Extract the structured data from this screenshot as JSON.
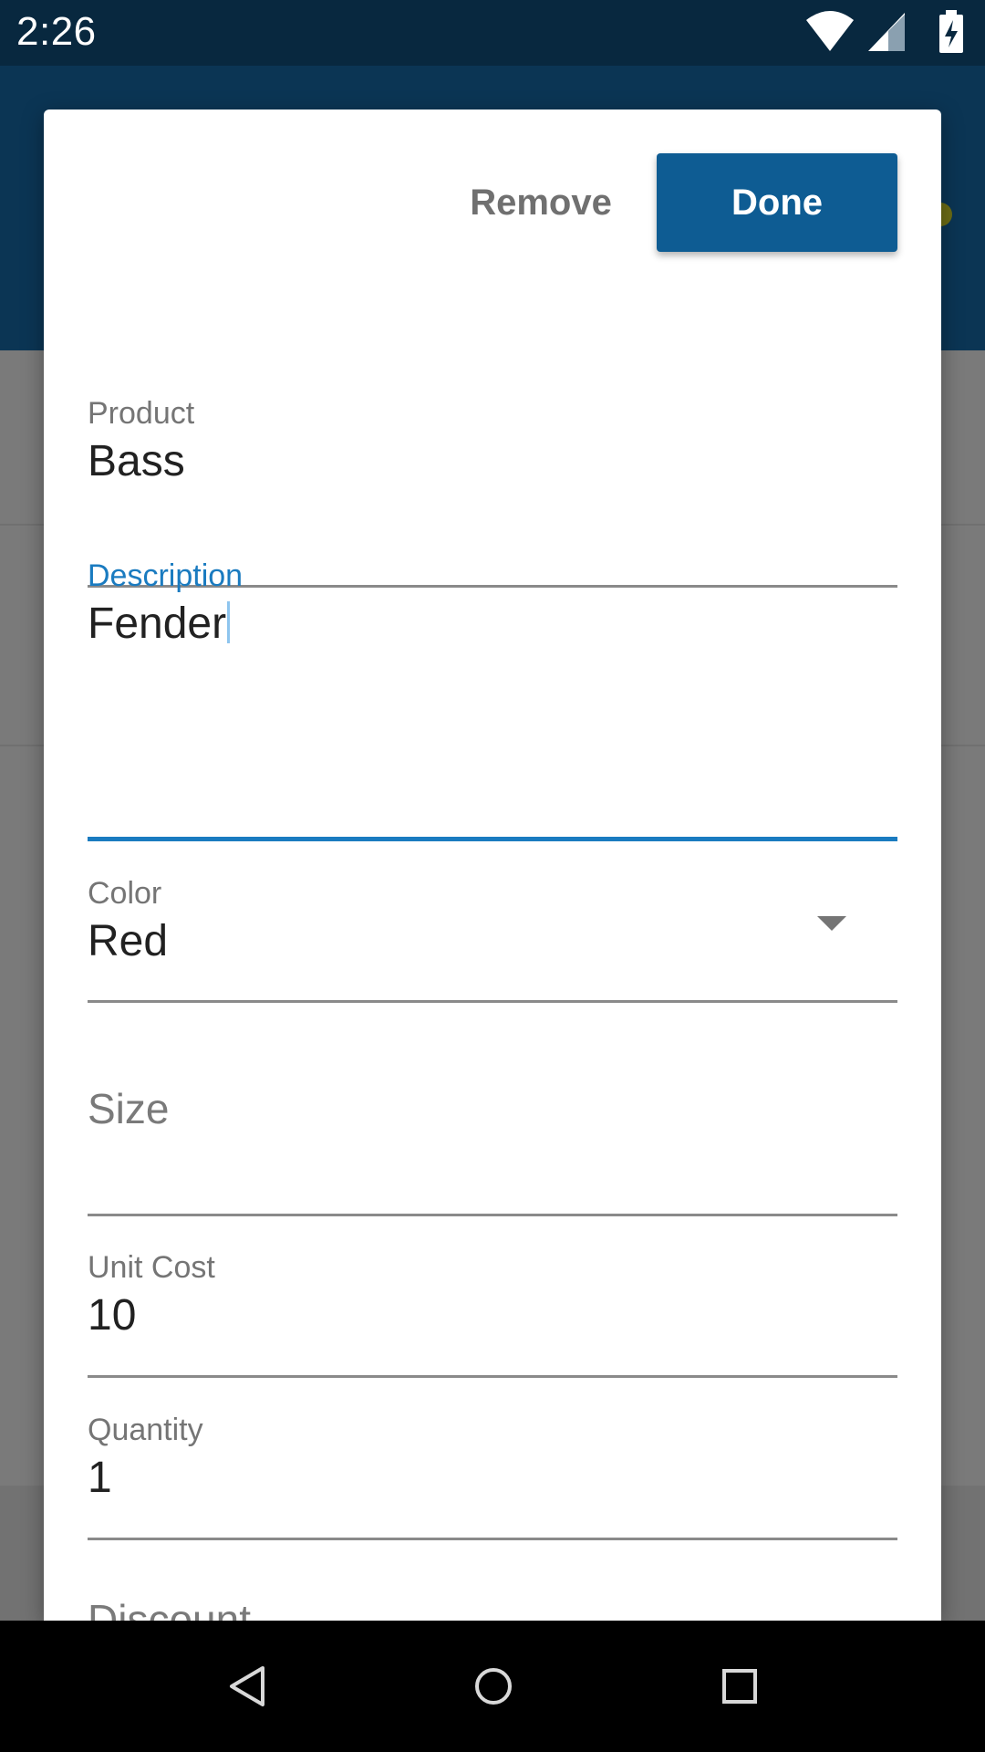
{
  "status_bar": {
    "time": "2:26",
    "icons": [
      "wifi-icon",
      "cell-signal-icon",
      "battery-charging-icon"
    ]
  },
  "colors": {
    "primary": "#0e5c93",
    "accent": "#1a7bc0",
    "status_bar": "#08283f"
  },
  "dialog": {
    "remove_label": "Remove",
    "done_label": "Done",
    "fields": {
      "product": {
        "label": "Product",
        "value": "Bass"
      },
      "description": {
        "label": "Description",
        "value": "Fender"
      },
      "color": {
        "label": "Color",
        "value": "Red"
      },
      "size": {
        "placeholder": "Size"
      },
      "unit_cost": {
        "label": "Unit Cost",
        "value": "10"
      },
      "quantity": {
        "label": "Quantity",
        "value": "1"
      },
      "discount": {
        "placeholder": "Discount"
      }
    }
  },
  "nav_bar": {
    "icons": [
      "back-icon",
      "home-icon",
      "recents-icon"
    ]
  }
}
